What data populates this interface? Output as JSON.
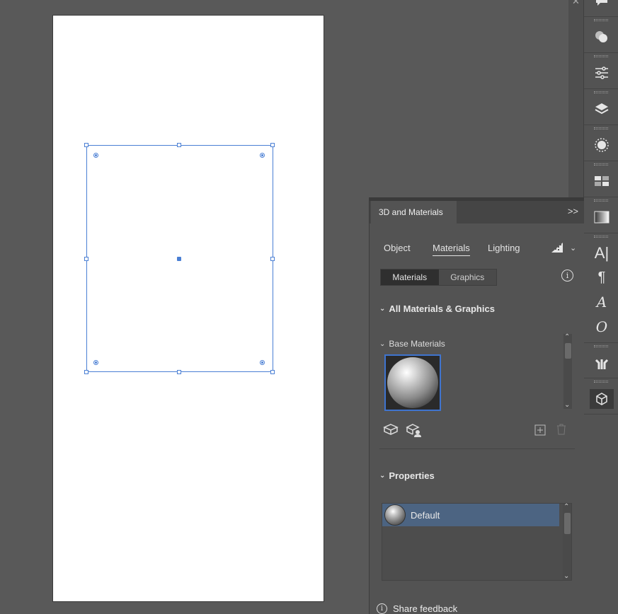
{
  "panel": {
    "title": "3D and Materials",
    "collapse_glyph": ">>",
    "tabs": [
      "Object",
      "Materials",
      "Lighting"
    ],
    "active_tab": "Materials",
    "toggle": {
      "left": "Materials",
      "right": "Graphics",
      "selected": "Materials"
    },
    "info_glyph": "i",
    "section_all": "All Materials & Graphics",
    "section_base": "Base Materials",
    "section_properties": "Properties",
    "properties_list": [
      {
        "label": "Default",
        "selected": true
      }
    ],
    "feedback": "Share feedback"
  },
  "toolbar": {
    "icons": [
      "comment-icon",
      "shape-builder-icon",
      "adjustments-icon",
      "layers-icon",
      "sun-icon",
      "swatches-icon",
      "gradient-icon",
      "character-icon",
      "paragraph-icon",
      "glyphs-icon",
      "opentype-icon",
      "puppet-warp-icon",
      "3d-cube-icon"
    ],
    "active": "3d-cube-icon"
  },
  "colors": {
    "accent": "#4a7fd4",
    "selected_row": "#4c6482"
  }
}
